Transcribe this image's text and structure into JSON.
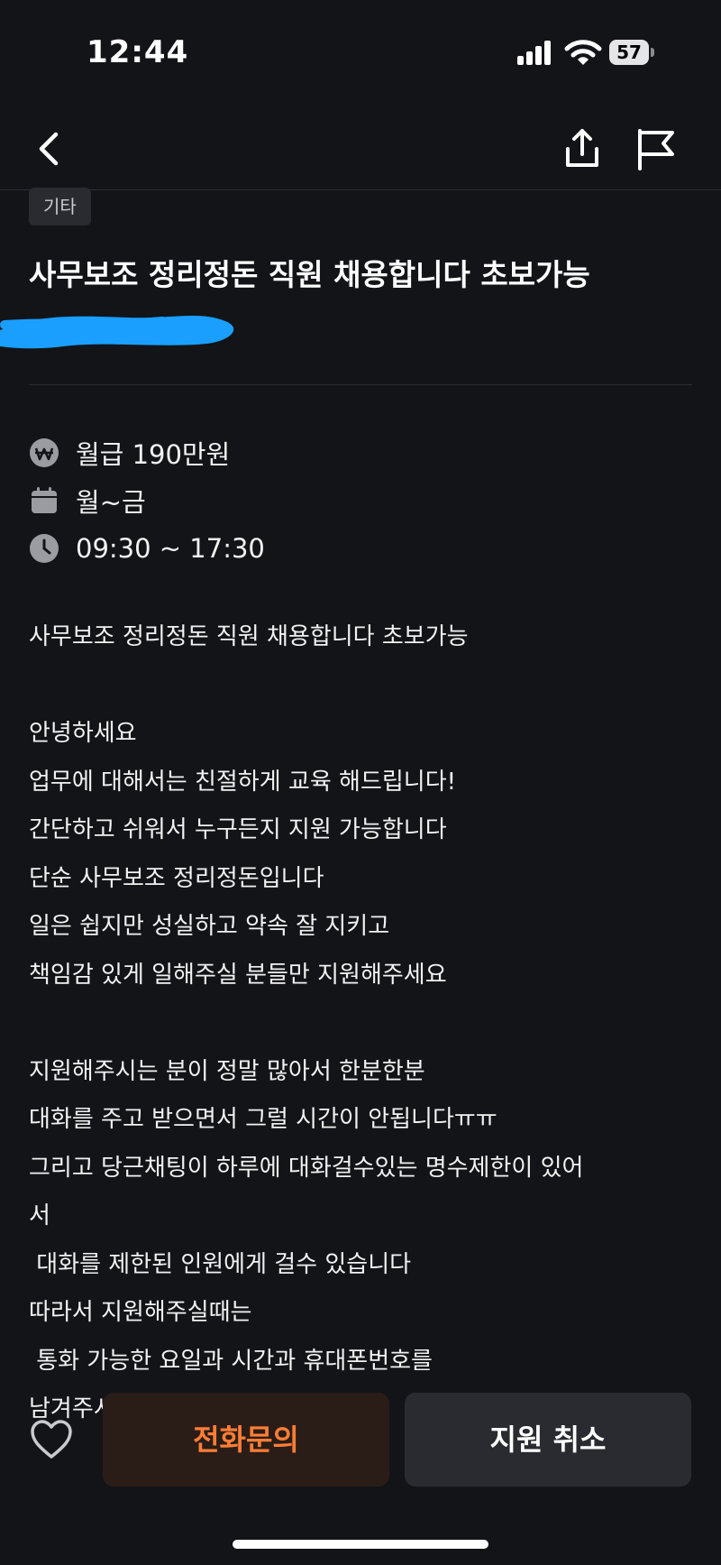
{
  "status": {
    "time": "12:44",
    "battery": "57"
  },
  "nav": {
    "back_icon": "chevron-left-icon",
    "share_icon": "share-icon",
    "report_icon": "flag-icon"
  },
  "post": {
    "category": "기타",
    "title": "사무보조 정리정돈 직원 채용합니다 초보가능",
    "info": {
      "salary": "월급 190만원",
      "days": "월~금",
      "hours": "09:30 ~ 17:30"
    },
    "description": "사무보조 정리정돈 직원 채용합니다 초보가능\n\n안녕하세요\n업무에 대해서는 친절하게 교육 해드립니다!\n간단하고 쉬워서 누구든지 지원 가능합니다\n단순 사무보조 정리정돈입니다\n일은 쉽지만 성실하고 약속 잘 지키고\n책임감 있게 일해주실 분들만 지원해주세요\n\n지원해주시는 분이 정말 많아서 한분한분\n대화를 주고 받으면서 그럴 시간이 안됩니다ㅠㅠ\n그리고 당근채팅이 하루에 대화걸수있는 명수제한이 있어\n서\n 대화를 제한된 인원에게 걸수 있습니다\n따라서 지원해주실때는\n 통화 가능한 요일과 시간과 휴대폰번호를\n남겨주시면 전화를 드리겠습니다"
  },
  "actions": {
    "call_label": "전화문의",
    "cancel_label": "지원 취소",
    "like_icon": "heart-outline-icon"
  },
  "colors": {
    "accent": "#ff7e36",
    "background": "#131418",
    "button_bg": "#2a2b30",
    "redaction": "#1a9fff"
  }
}
